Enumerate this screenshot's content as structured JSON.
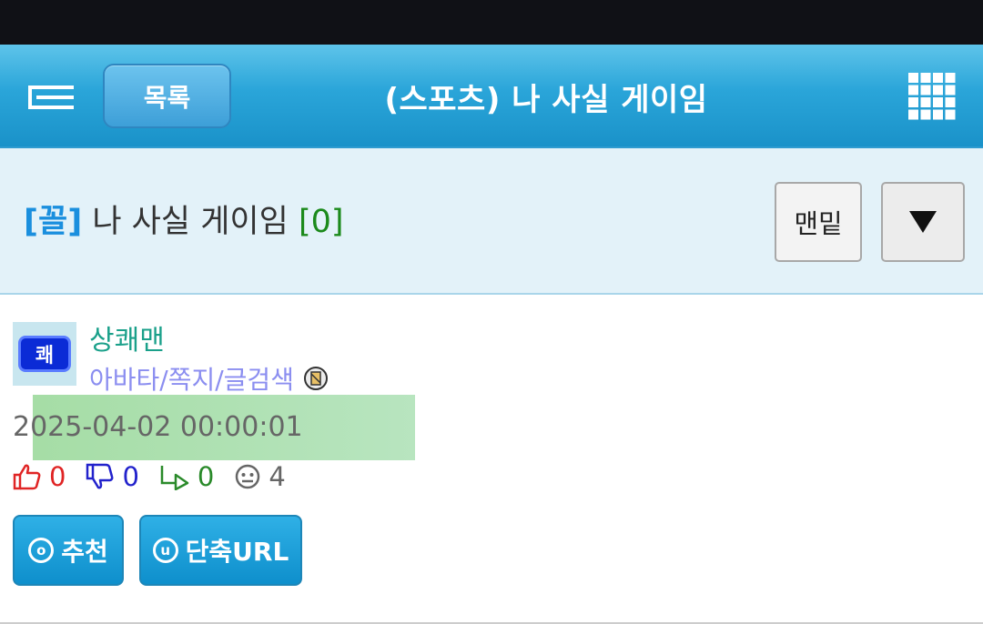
{
  "nav": {
    "list_label": "목록",
    "title": "(스포츠) 나 사실 게이임"
  },
  "subject": {
    "tag": "[꼴]",
    "title": "나 사실 게이임",
    "comment_count": "[0]",
    "bottom_label": "맨밑",
    "down_glyph": "▼"
  },
  "post": {
    "avatar_text": "쾌",
    "author": "상쾌맨",
    "author_links": "아바타/쪽지/글검색",
    "date": "2025-04-02 00:00:01",
    "upvotes": "0",
    "downvotes": "0",
    "replies": "0",
    "views": "4"
  },
  "actions": {
    "recommend_icon": "o",
    "recommend_label": "추천",
    "shorturl_icon": "u",
    "shorturl_label": "단축URL"
  },
  "colors": {
    "nav_blue": "#1a92c9",
    "subject_bg": "#e3f2f9",
    "tag_blue": "#1a8fde",
    "count_green": "#1b8a1b",
    "author_teal": "#1aa08a",
    "link_purple": "#8b8ef0",
    "upvote_red": "#e02424",
    "downvote_blue": "#2222cc"
  },
  "icons": [
    "menu-icon",
    "apps-grid-icon",
    "down-arrow-icon",
    "memo-icon",
    "thumbs-up-icon",
    "thumbs-down-icon",
    "reply-icon",
    "views-icon"
  ]
}
